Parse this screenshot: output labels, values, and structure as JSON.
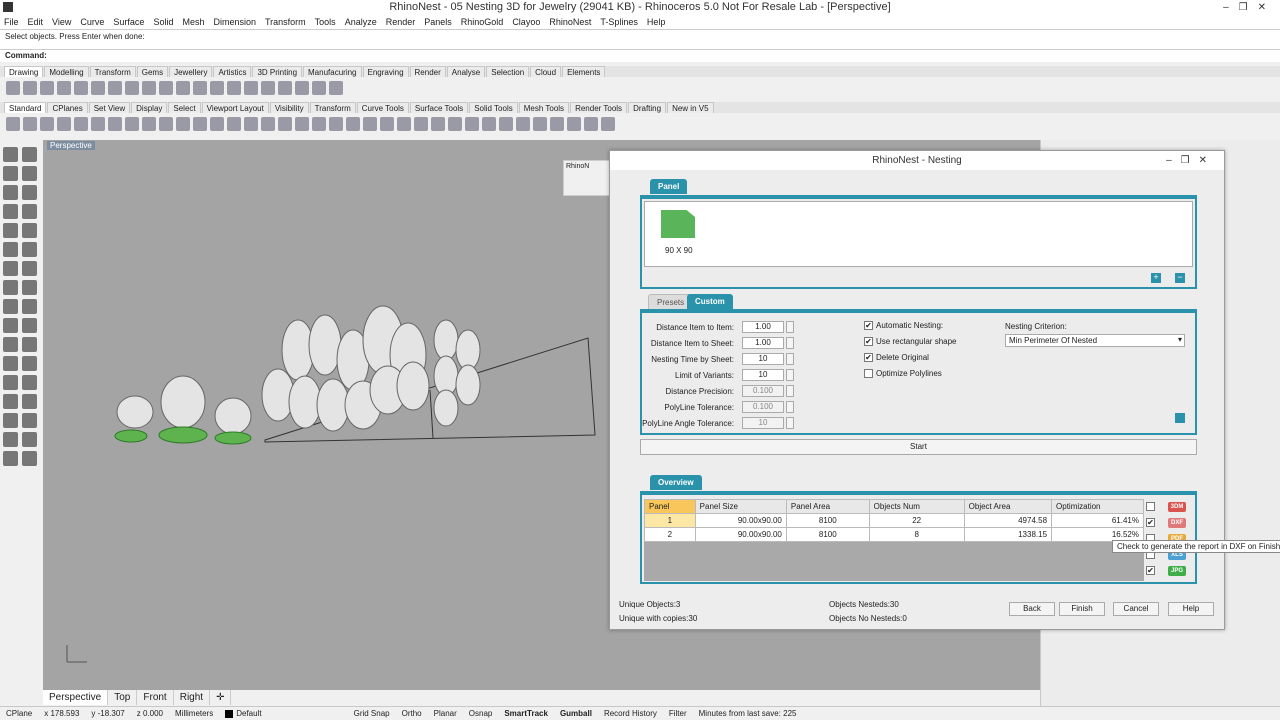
{
  "window": {
    "title": "RhinoNest - 05 Nesting 3D for Jewelry (29041 KB) - Rhinoceros 5.0 Not For Resale Lab - [Perspective]"
  },
  "menu": [
    "File",
    "Edit",
    "View",
    "Curve",
    "Surface",
    "Solid",
    "Mesh",
    "Dimension",
    "Transform",
    "Tools",
    "Analyze",
    "Render",
    "Panels",
    "RhinoGold",
    "Clayoo",
    "RhinoNest",
    "T-Splines",
    "Help"
  ],
  "command": {
    "history": "Select objects. Press Enter when done:",
    "prompt": "Command:"
  },
  "toolbar_tabs_1": [
    "Drawing",
    "Modelling",
    "Transform",
    "Gems",
    "Jewellery",
    "Artistics",
    "3D Printing",
    "Manufacuring",
    "Engraving",
    "Render",
    "Analyse",
    "Selection",
    "Cloud",
    "Elements"
  ],
  "toolbar_tabs_2": [
    "Standard",
    "CPlanes",
    "Set View",
    "Display",
    "Select",
    "Viewport Layout",
    "Visibility",
    "Transform",
    "Curve Tools",
    "Surface Tools",
    "Solid Tools",
    "Mesh Tools",
    "Render Tools",
    "Drafting",
    "New in V5"
  ],
  "viewport": {
    "label": "Perspective",
    "mini_label": "RhinoN"
  },
  "viewport_tabs": [
    "Perspective",
    "Top",
    "Front",
    "Right"
  ],
  "status": {
    "cplane": "CPlane",
    "x": "x 178.593",
    "y": "y -18.307",
    "z": "z 0.000",
    "units": "Millimeters",
    "layer": "Default",
    "items": [
      "Grid Snap",
      "Ortho",
      "Planar",
      "Osnap",
      "SmartTrack",
      "Gumball",
      "Record History",
      "Filter",
      "Minutes from last save: 225"
    ]
  },
  "dialog": {
    "title": "RhinoNest - Nesting",
    "panel_tab": "Panel",
    "panel_item": "90 X 90",
    "tabs": [
      "Presets",
      "Custom"
    ],
    "fields": [
      {
        "label": "Distance Item to Item:",
        "value": "1.00",
        "disabled": false
      },
      {
        "label": "Distance Item to Sheet:",
        "value": "1.00",
        "disabled": false
      },
      {
        "label": "Nesting Time by Sheet:",
        "value": "10",
        "disabled": false
      },
      {
        "label": "Limit of Variants:",
        "value": "10",
        "disabled": false
      },
      {
        "label": "Distance Precision:",
        "value": "0.100",
        "disabled": true
      },
      {
        "label": "PolyLine Tolerance:",
        "value": "0.100",
        "disabled": true
      },
      {
        "label": "PolyLine Angle Tolerance:",
        "value": "10",
        "disabled": true
      }
    ],
    "checks": [
      {
        "label": "Automatic Nesting:",
        "checked": true
      },
      {
        "label": "Use rectangular shape",
        "checked": true
      },
      {
        "label": "Delete Original",
        "checked": true
      },
      {
        "label": "Optimize Polylines",
        "checked": false
      }
    ],
    "criterion_label": "Nesting Criterion:",
    "criterion_value": "Min Perimeter Of Nested",
    "start": "Start",
    "overview_tab": "Overview",
    "table_headers": [
      "Panel",
      "Panel Size",
      "Panel Area",
      "Objects Num",
      "Object Area",
      "Optimization"
    ],
    "table_rows": [
      [
        "1",
        "90.00x90.00",
        "8100",
        "22",
        "4974.58",
        "61.41%"
      ],
      [
        "2",
        "90.00x90.00",
        "8100",
        "8",
        "1338.15",
        "16.52%"
      ]
    ],
    "reports": [
      {
        "label": "3DM",
        "checked": false,
        "color": "#d9534f"
      },
      {
        "label": "DXF",
        "checked": true,
        "color": "#e07a7a"
      },
      {
        "label": "PDF",
        "checked": false,
        "color": "#e8a93b"
      },
      {
        "label": "XLS",
        "checked": false,
        "color": "#4a9fd5"
      },
      {
        "label": "JPG",
        "checked": true,
        "color": "#3fae49"
      }
    ],
    "tooltip": "Check to generate the report in DXF on Finish",
    "footer": {
      "unique": "Unique Objects:3",
      "unique_copies": "Unique with copies:30",
      "nested": "Objects Nesteds:30",
      "not_nested": "Objects No Nesteds:0"
    },
    "buttons": [
      "Back",
      "Finish",
      "Cancel",
      "Help"
    ]
  }
}
